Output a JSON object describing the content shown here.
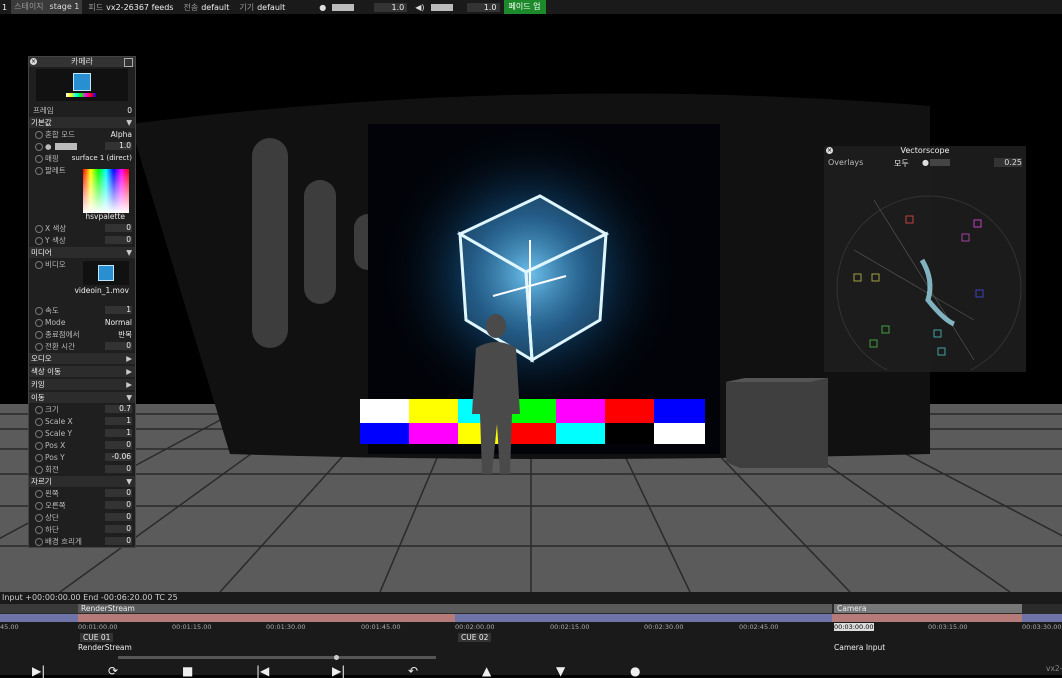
{
  "topbar": {
    "stage_num": "1",
    "stage_label": "스테이지",
    "stage_value": "stage 1",
    "feed_label": "피드",
    "feed_value": "vx2-26367 feeds",
    "transmit_label": "전송",
    "transmit_value": "default",
    "device_label": "기기",
    "device_value": "default",
    "brightness_value": "1.0",
    "volume_value": "1.0",
    "fade_label": "페이드 업"
  },
  "panel": {
    "title": "카메라",
    "frame_label": "프레임",
    "frame_value": "0",
    "basic_section": "기본값",
    "blend_label": "혼합 모드",
    "blend_value": "Alpha",
    "brightness_value": "1.0",
    "mapping_label": "매핑",
    "mapping_value": "surface 1 (direct)",
    "palette_label": "팔레트",
    "palette_value": "hsvpalette",
    "x_color_label": "X 색상",
    "x_color_value": "0",
    "y_color_label": "Y 색상",
    "y_color_value": "0",
    "media_section": "미디어",
    "video_label": "비디오",
    "video_value": "videoin_1.mov",
    "speed_label": "속도",
    "speed_value": "1",
    "mode_label": "Mode",
    "mode_value": "Normal",
    "endpoint_label": "종료점에서",
    "endpoint_value": "반복",
    "transition_label": "전환 시간",
    "transition_value": "0",
    "audio_section": "오디오",
    "color_shift_section": "색상 이동",
    "keying_section": "키잉",
    "move_section": "이동",
    "size_label": "크기",
    "size_value": "0.7",
    "scalex_label": "Scale X",
    "scalex_value": "1",
    "scaley_label": "Scale Y",
    "scaley_value": "1",
    "posx_label": "Pos X",
    "posx_value": "0",
    "posy_label": "Pos Y",
    "posy_value": "-0.06",
    "rotate_label": "회전",
    "rotate_value": "0",
    "crop_section": "자르기",
    "left_label": "왼쪽",
    "left_value": "0",
    "right_label": "오른쪽",
    "right_value": "0",
    "top_label": "상단",
    "top_value": "0",
    "bottom_label": "하단",
    "bottom_value": "0",
    "blur_label": "배경 흐리게",
    "blur_value": "0"
  },
  "vectorscope": {
    "title": "Vectorscope",
    "overlays_label": "Overlays",
    "overlays_value": "모두",
    "level_value": "0.25"
  },
  "timeline": {
    "input_info": "Input +00:00:00.00   End -00:06:20.00   TC 25",
    "track1_label": "RenderStream",
    "track2_label": "Camera",
    "ticks": [
      "45.00",
      "00:01:00.00",
      "00:01:15.00",
      "00:01:30.00",
      "00:01:45.00",
      "00:02:00.00",
      "00:02:15.00",
      "00:02:30.00",
      "00:02:45.00",
      "00:03:00.00",
      "00:03:15.00",
      "00:03:30.00"
    ],
    "cue1": "CUE 01",
    "cue2": "CUE 02",
    "layer1_label": "RenderStream",
    "layer2_label": "Camera Input",
    "corner": "vx2-"
  },
  "colors": {
    "accent_green": "#1c8a2a",
    "panel_bg": "#1f1f1f",
    "track_pink": "#b57b7b",
    "track_blue": "#6e74a8"
  }
}
